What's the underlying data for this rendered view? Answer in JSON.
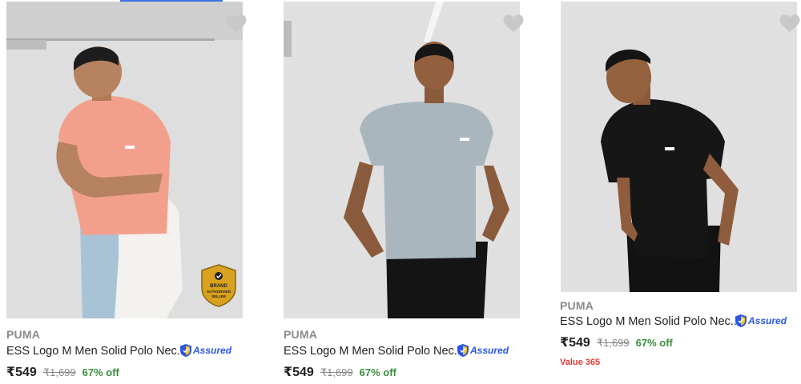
{
  "products": [
    {
      "brand": "PUMA",
      "title": "ESS Logo M Men Solid Polo Nec...",
      "assured_label": "Assured",
      "price": "₹549",
      "mrp": "₹1,699",
      "discount": "67% off",
      "shirt_color": "#f2a08c",
      "badge": {
        "line1": "BRAND",
        "line2": "AUTHORISED",
        "line3": "SELLER"
      }
    },
    {
      "brand": "PUMA",
      "title": "ESS Logo M Men Solid Polo Nec...",
      "assured_label": "Assured",
      "price": "₹549",
      "mrp": "₹1,699",
      "discount": "67% off",
      "shirt_color": "#a9b6bd"
    },
    {
      "brand": "PUMA",
      "title": "ESS Logo M Men Solid Polo Nec...",
      "assured_label": "Assured",
      "price": "₹549",
      "mrp": "₹1,699",
      "discount": "67% off",
      "shirt_color": "#161616",
      "value_tag": "Value 365"
    }
  ],
  "icons": {
    "wishlist": "heart-icon",
    "assured": "shield-icon"
  },
  "colors": {
    "price_off": "#388e3c",
    "assured": "#2a55e5",
    "value_tag": "#e53935",
    "wishlist": "#c8c8c8"
  }
}
